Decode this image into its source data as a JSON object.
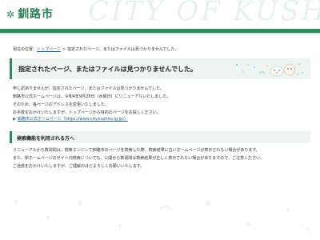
{
  "header": {
    "logo_mark": "✲",
    "logo_text": "釧路市",
    "watermark": "CITY OF KUSHIRO"
  },
  "breadcrumb": {
    "label": "現在の位置：",
    "top_link": "トップページ",
    "separator": ">",
    "current": "指定されたページ、またはファイルは見つかりませんでした。"
  },
  "title": "指定されたページ、またはファイルは見つかりませんでした。",
  "body_lines": [
    "申し訳ありませんが、指定されたページ、またはファイルは見つかりませんでした。",
    "釧路市公式ホームページは、令和4年9月28日（水曜日）にリニューアルいたしました。",
    "そのため、各ページのアドレスを変更いたしました。",
    "お手数をおかけいたしますが、トップページから目的のページをお探しください。"
  ],
  "home_link": {
    "icon": "arrow-right-icon",
    "text": "釧路市公式ホームページ（https://www.city.kushiro.lg.jp/）"
  },
  "search_section": {
    "title": "検索機能を利用される方へ",
    "lines": [
      "リニューアルから数週間は、検索エンジンで釧路市のページを検索した際、検索結果に古いホームページが表示されない場合があります。",
      "また、新ホームページのサイト内検索についても、公開から数週間は検索結果が正しく表示されない場合がありますので、ご注意ください。",
      "ご迷惑をおかけいたしますが、ご理解のほどよろしくお願いいたします。"
    ]
  },
  "colors": {
    "brand_green": "#2f8a62",
    "panel_bg": "#eef4f1",
    "link": "#1a5ea8"
  }
}
